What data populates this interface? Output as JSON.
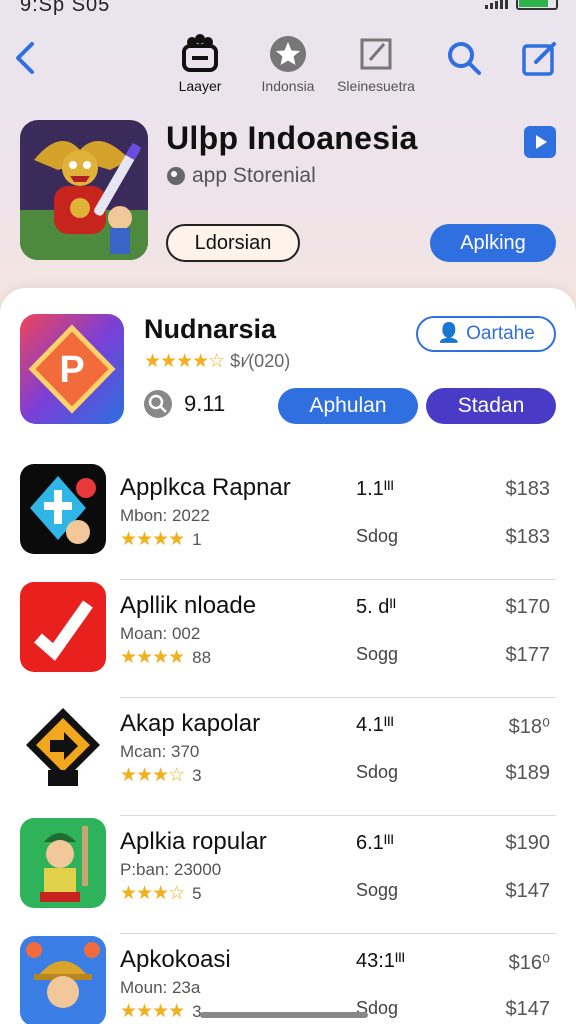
{
  "status": {
    "time": "9:Sp S05"
  },
  "nav": {
    "tabs": [
      {
        "label": "Laayer"
      },
      {
        "label": "Indonsia"
      },
      {
        "label": "Sleinesuetra"
      }
    ]
  },
  "hero": {
    "title": "Ulþp Indoanesia",
    "subtitle": "app Storenial",
    "btn_outline": "Ldorsian",
    "btn_primary": "Aplking"
  },
  "featured": {
    "title": "Nudnarsia",
    "rating_text": "$ı⁄(020)",
    "search_value": "9.11",
    "btn_outline": "Oartahe",
    "btn_blue": "Aphulan",
    "btn_purple": "Stadan"
  },
  "apps": [
    {
      "name": "Applkca Rapnar",
      "meta": "Mbon: 2022",
      "stars": "★★★★",
      "rating": "1",
      "version": "1.1ᴵᴵᴵ",
      "size": "Sdog",
      "price1": "$183",
      "price2": "$183"
    },
    {
      "name": "Apllik nloade",
      "meta": "Moan: 002",
      "stars": "★★★★",
      "rating": "88",
      "version": "5. dᴵᴵ",
      "size": "Sogg",
      "price1": "$170",
      "price2": "$177"
    },
    {
      "name": "Akap kapolar",
      "meta": "Mcan: 370",
      "stars": "★★★☆",
      "rating": "3",
      "version": "4.1ᴵᴵᴵ",
      "size": "Sdog",
      "price1": "$18⁰",
      "price2": "$189"
    },
    {
      "name": "Aplkia ropular",
      "meta": "P:ban: 23000",
      "stars": "★★★☆",
      "rating": "5",
      "version": "6.1ᴵᴵᴵ",
      "size": "Sogg",
      "price1": "$190",
      "price2": "$147"
    },
    {
      "name": "Apkokoasi",
      "meta": "Moun: 23a",
      "stars": "★★★★",
      "rating": "3",
      "version": "43:1ᴵᴵᴵ",
      "size": "Sdog",
      "price1": "$16⁰",
      "price2": "$147"
    }
  ]
}
